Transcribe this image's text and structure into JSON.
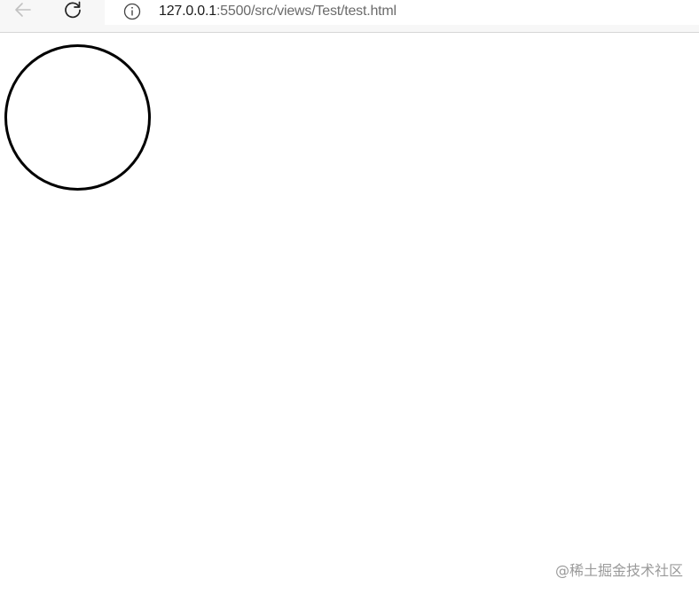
{
  "browser": {
    "back_icon": "arrow-left-icon",
    "reload_icon": "reload-icon",
    "info_icon": "info-icon",
    "url_host": "127.0.0.1",
    "url_rest": ":5500/src/views/Test/test.html"
  },
  "page": {
    "shape": "circle-outline",
    "stroke_color": "#000000"
  },
  "watermark": {
    "text": "@稀土掘金技术社区"
  }
}
